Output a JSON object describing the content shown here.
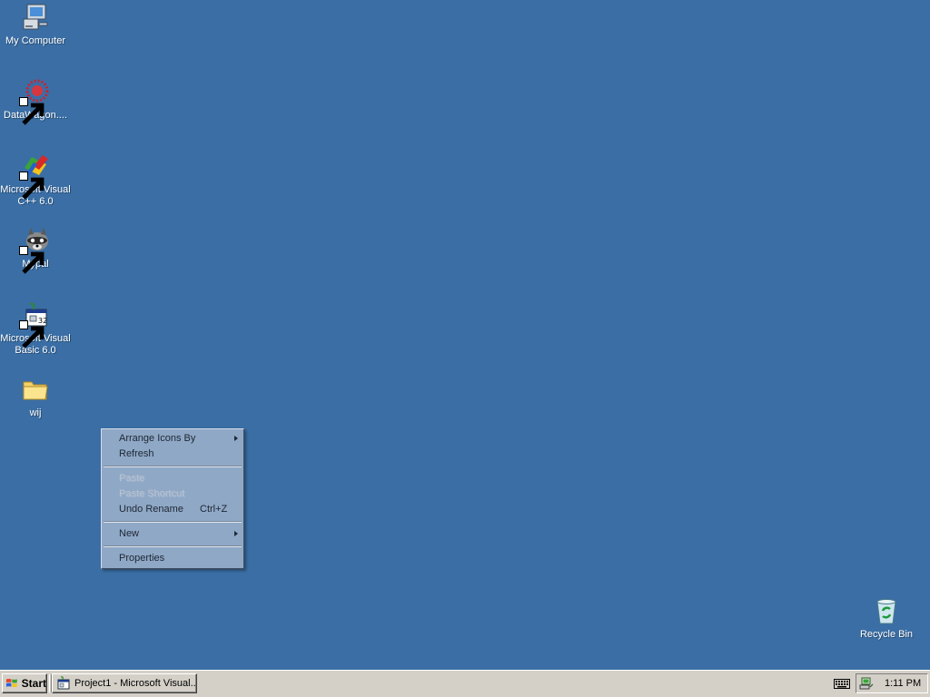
{
  "desktop": {
    "background_color": "#3a6ea5",
    "icons": [
      {
        "label": "My Computer",
        "icon": "my-computer-icon"
      },
      {
        "label": "DataWagon....",
        "icon": "datawagon-icon"
      },
      {
        "label": "Microsoft Visual\nC++ 6.0",
        "icon": "visual-cpp-icon"
      },
      {
        "label": "Mypal",
        "icon": "mypal-raccoon-icon"
      },
      {
        "label": "Microsoft Visual\nBasic 6.0",
        "icon": "visual-basic-icon"
      },
      {
        "label": "wij",
        "icon": "folder-icon"
      },
      {
        "label": "Recycle Bin",
        "icon": "recycle-bin-icon"
      }
    ]
  },
  "context_menu": {
    "items": [
      {
        "label": "Arrange Icons By",
        "submenu": true,
        "enabled": true
      },
      {
        "label": "Refresh",
        "enabled": true
      },
      {
        "label": "Paste",
        "enabled": false
      },
      {
        "label": "Paste Shortcut",
        "enabled": false
      },
      {
        "label": "Undo Rename",
        "shortcut": "Ctrl+Z",
        "enabled": true
      },
      {
        "label": "New",
        "submenu": true,
        "enabled": true
      },
      {
        "label": "Properties",
        "enabled": true
      }
    ]
  },
  "taskbar": {
    "start_label": "Start",
    "tasks": [
      {
        "label": "Project1 - Microsoft Visual...",
        "icon": "visual-basic-icon"
      }
    ],
    "tray": {
      "clock": "1:11 PM",
      "icons": [
        "keyboard-icon",
        "network-icon"
      ]
    }
  }
}
